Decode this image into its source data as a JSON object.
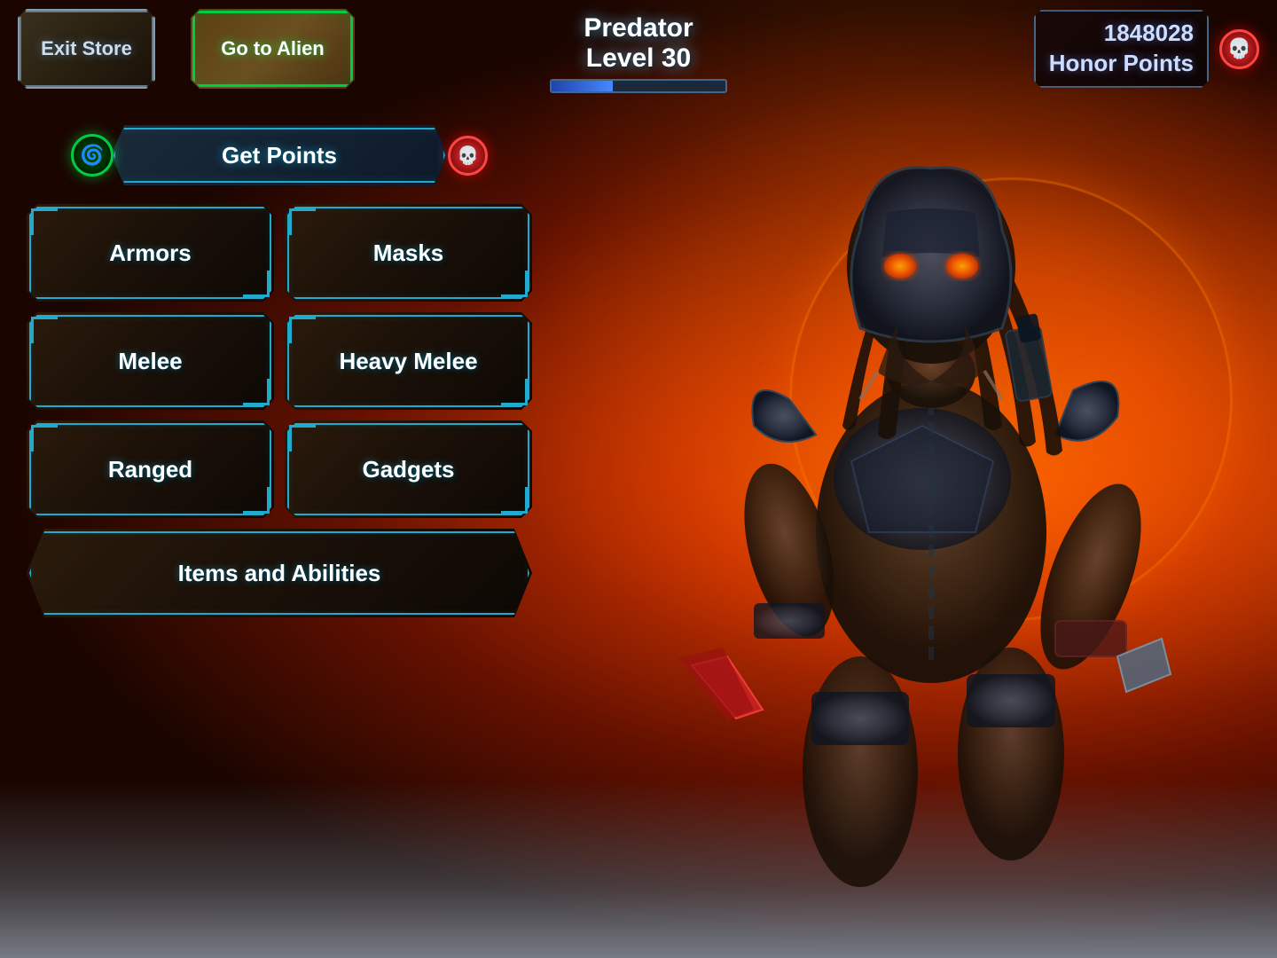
{
  "background": {
    "color": "#1a0500"
  },
  "header": {
    "exit_store_label": "Exit\nStore",
    "goto_alien_label": "Go to\nAlien",
    "player_name": "Predator",
    "player_level_label": "Level 30",
    "honor_points_line1": "1848028",
    "honor_points_line2": "Honor Points",
    "xp_percent": 35
  },
  "menu": {
    "get_points_label": "Get Points",
    "armors_label": "Armors",
    "masks_label": "Masks",
    "melee_label": "Melee",
    "heavy_melee_label": "Heavy Melee",
    "ranged_label": "Ranged",
    "gadgets_label": "Gadgets",
    "items_abilities_label": "Items and Abilities"
  },
  "icons": {
    "skull": "💀",
    "swirl": "🌀"
  }
}
